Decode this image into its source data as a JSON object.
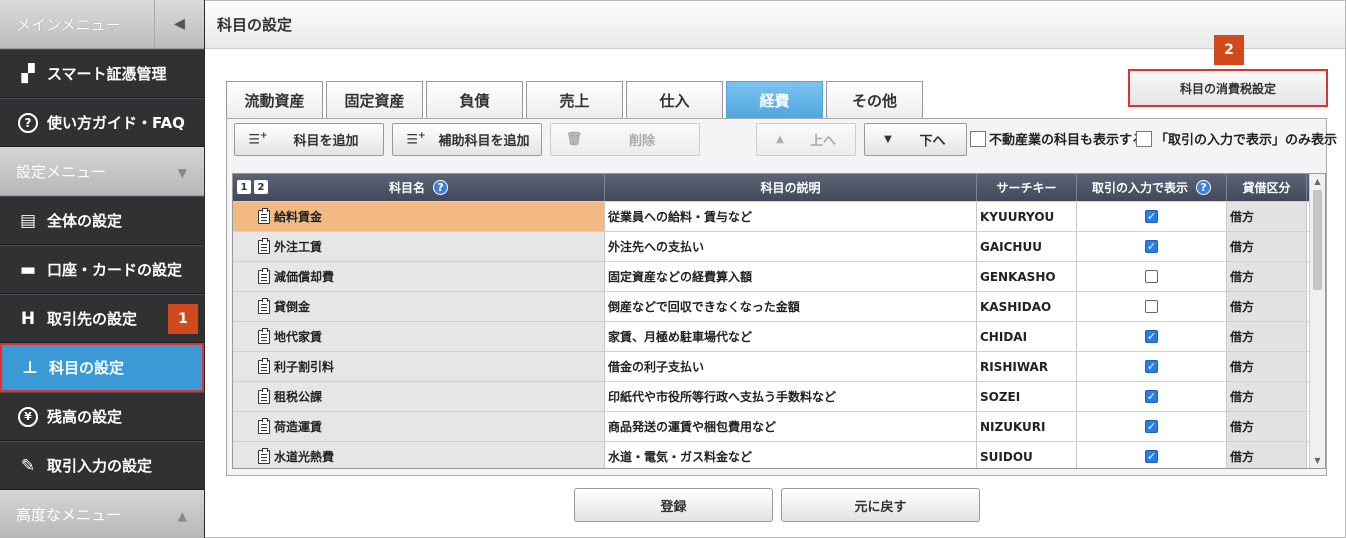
{
  "sidebar": {
    "main_menu_label": "メインメニュー",
    "items_top": [
      {
        "label": "スマート証憑管理",
        "icon": "receipt-scan-icon",
        "glyph": "▞"
      },
      {
        "label": "使い方ガイド・FAQ",
        "icon": "help-circle-icon",
        "glyph": "?"
      }
    ],
    "settings_label": "設定メニュー",
    "items_settings": [
      {
        "label": "全体の設定",
        "icon": "settings-document-icon",
        "glyph": "▤"
      },
      {
        "label": "口座・カードの設定",
        "icon": "bank-card-icon",
        "glyph": "▬"
      },
      {
        "label": "取引先の設定",
        "icon": "partner-icon",
        "glyph": "H"
      },
      {
        "label": "科目の設定",
        "icon": "account-tree-icon",
        "glyph": "⊥"
      },
      {
        "label": "残高の設定",
        "icon": "yen-coin-icon",
        "glyph": "¥"
      },
      {
        "label": "取引入力の設定",
        "icon": "pen-settings-icon",
        "glyph": "✎"
      }
    ],
    "advanced_label": "高度なメニュー",
    "badge1": "1"
  },
  "header": {
    "title": "科目の設定"
  },
  "tabs": [
    "流動資産",
    "固定資産",
    "負債",
    "売上",
    "仕入",
    "経費",
    "その他"
  ],
  "active_tab_index": 5,
  "tax_button_label": "科目の消費税設定",
  "badge2": "2",
  "toolbar": {
    "add_account": "科目を追加",
    "add_sub_account": "補助科目を追加",
    "delete": "削除",
    "move_up": "上へ",
    "move_down": "下へ",
    "show_real_estate": "不動産業の科目も表示する",
    "show_only_transaction": "「取引の入力で表示」のみ表示"
  },
  "grid": {
    "headers": {
      "name": "科目名",
      "description": "科目の説明",
      "search_key": "サーチキー",
      "show_in_transaction": "取引の入力で表示",
      "debit_credit": "貸借区分",
      "level1": "1",
      "level2": "2"
    },
    "rows": [
      {
        "name": "給料賃金",
        "description": "従業員への給料・賃与など",
        "key": "KYUURYOU",
        "show": true,
        "type": "借方"
      },
      {
        "name": "外注工賃",
        "description": "外注先への支払い",
        "key": "GAICHUU",
        "show": true,
        "type": "借方"
      },
      {
        "name": "減価償却費",
        "description": "固定資産などの経費算入額",
        "key": "GENKASHO",
        "show": false,
        "type": "借方"
      },
      {
        "name": "貸倒金",
        "description": "倒産などで回収できなくなった金額",
        "key": "KASHIDAO",
        "show": false,
        "type": "借方"
      },
      {
        "name": "地代家賃",
        "description": "家賃、月極め駐車場代など",
        "key": "CHIDAI",
        "show": true,
        "type": "借方"
      },
      {
        "name": "利子割引料",
        "description": "借金の利子支払い",
        "key": "RISHIWAR",
        "show": true,
        "type": "借方"
      },
      {
        "name": "租税公課",
        "description": "印紙代や市役所等行政へ支払う手数料など",
        "key": "SOZEI",
        "show": true,
        "type": "借方"
      },
      {
        "name": "荷造運賃",
        "description": "商品発送の運賃や梱包費用など",
        "key": "NIZUKURI",
        "show": true,
        "type": "借方"
      },
      {
        "name": "水道光熱費",
        "description": "水道・電気・ガス料金など",
        "key": "SUIDOU",
        "show": true,
        "type": "借方"
      }
    ],
    "selected_index": 0
  },
  "footer": {
    "register": "登録",
    "revert": "元に戻す"
  }
}
